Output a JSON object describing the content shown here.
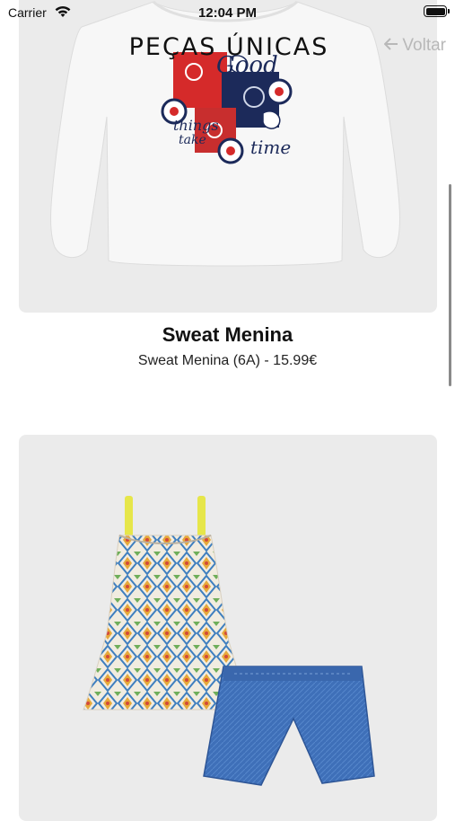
{
  "status_bar": {
    "carrier": "Carrier",
    "time": "12:04 PM"
  },
  "nav": {
    "title": "PEÇAS ÚNICAS",
    "back_label": "Voltar",
    "back_icon": "arrow-left-icon"
  },
  "products": [
    {
      "name": "Sweat Menina",
      "subtitle": "Sweat Menina (6A) - 15.99€",
      "print_text": [
        "Good",
        "things",
        "take",
        "time"
      ]
    },
    {
      "name": "",
      "subtitle": ""
    }
  ],
  "colors": {
    "card_bg": "#ebebeb",
    "back_text": "#b8b8b8",
    "accent_red": "#d52a2a",
    "accent_navy": "#1c2a5a"
  }
}
